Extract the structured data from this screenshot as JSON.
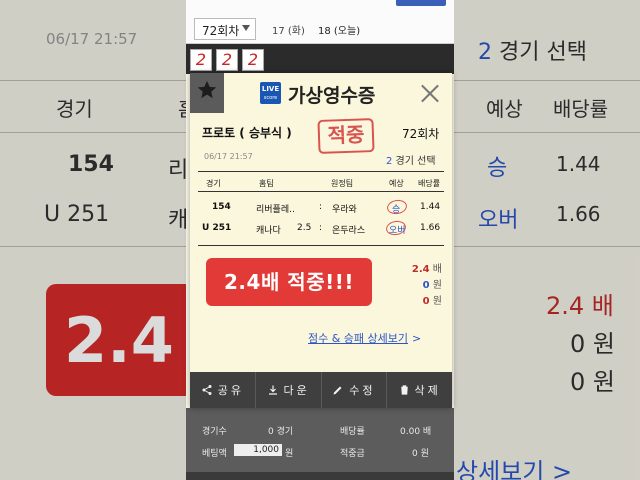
{
  "colors": {
    "accent_blue": "#2b55c8",
    "hit_red": "#e23a36",
    "stamp_red": "#d9534f",
    "action_bar": "#3f3f3f"
  },
  "background": {
    "date": "06/17  21:57",
    "sel_num": "2",
    "sel_text": " 경기 선택",
    "h_game": "경기",
    "h_home": "홈",
    "h_pick": "예상",
    "h_odds": "배당률",
    "r1_no": "154",
    "r1_team": "리",
    "r1_pick": "승",
    "r1_odds": "1.44",
    "r2_no": "U 251",
    "r2_team": "캐나",
    "r2_pick": "오버",
    "r2_odds": "1.66",
    "big": "2.4",
    "s1": "2.4 배",
    "s2": "0 원",
    "s3": "0 원",
    "more": "상세보기 >"
  },
  "screen": {
    "round_select": "72회차",
    "tab_17": "17 (화)",
    "tab_18": "18 (오늘)",
    "stamps": [
      "2",
      "2",
      "2"
    ]
  },
  "modal": {
    "logo_top": "LIVE",
    "logo_sub": "score",
    "title": "가상영수증",
    "game_type": "프로토 ( 승부식 )",
    "hit_stamp": "적중",
    "round": "72회차",
    "datetime": "06/17  21:57",
    "selected_num": "2",
    "selected_text": " 경기 선택",
    "headers": {
      "game": "경기",
      "home": "홈팀",
      "away": "원정팀",
      "pick": "예상",
      "odds": "배당률"
    },
    "rows": [
      {
        "no": "154",
        "home": "리버플레..",
        "handicap": "",
        "sep": ":",
        "away": "우라와",
        "pick": "승",
        "odds": "1.44"
      },
      {
        "no": "U 251",
        "home": "캐나다",
        "handicap": "2.5",
        "sep": ":",
        "away": "온두라스",
        "pick": "오버",
        "odds": "1.66"
      }
    ],
    "result_banner": "2.4배 적중!!!",
    "summary": {
      "odds_value": "2.4",
      "odds_unit": " 배",
      "bet_value": "0",
      "bet_unit": " 원",
      "win_value": "0",
      "win_unit": " 원"
    },
    "detail_link": "점수 & 승패 상세보기",
    "detail_arrow": ">",
    "actions": {
      "share": "공유",
      "download": "다운",
      "edit": "수정",
      "delete": "삭제"
    }
  },
  "footer": {
    "games_label": "경기수",
    "games_value": "0 경기",
    "odds_label": "배당률",
    "odds_value": "0.00 배",
    "bet_label": "베팅액",
    "bet_value": "1,000",
    "bet_unit": "원",
    "win_label": "적중금",
    "win_value": "0 원"
  }
}
